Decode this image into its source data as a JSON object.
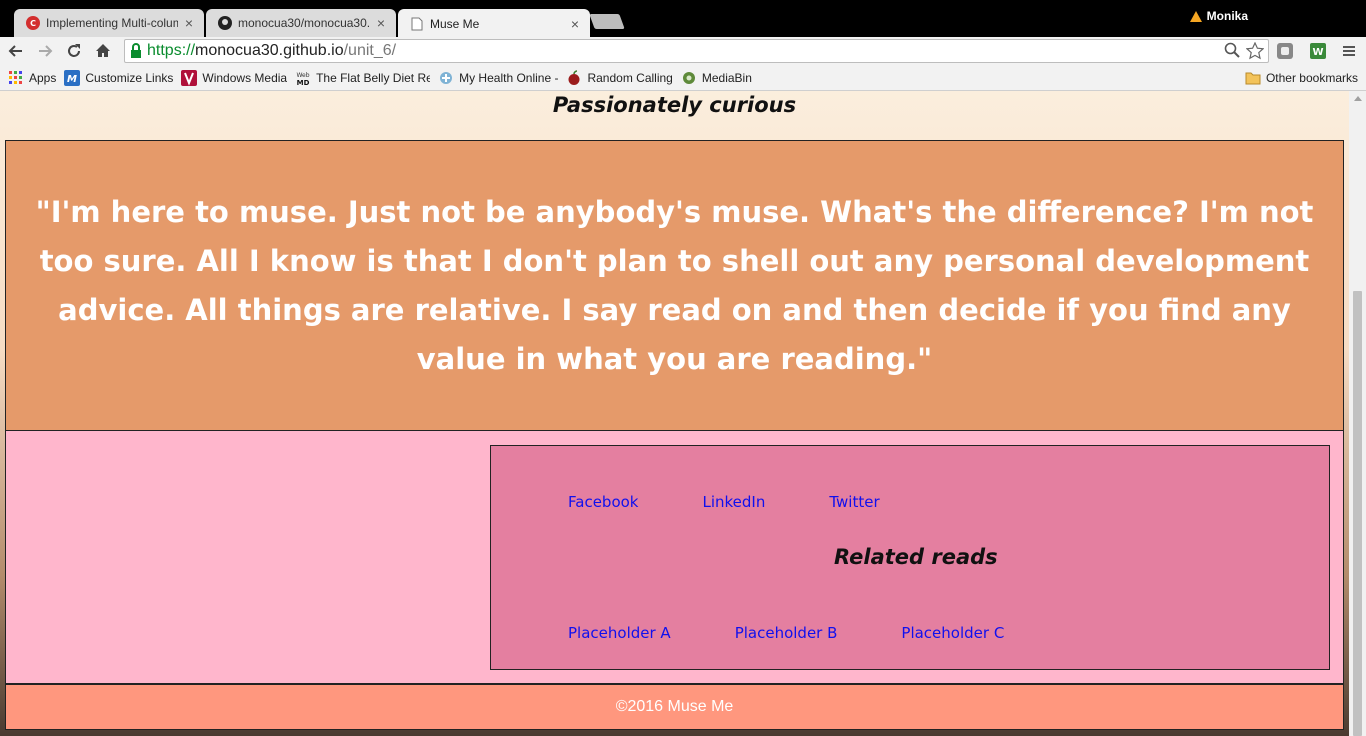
{
  "browser": {
    "tabs": [
      {
        "title": "Implementing Multi-colum",
        "icon": "codecademy-icon",
        "active": false
      },
      {
        "title": "monocua30/monocua30.g",
        "icon": "github-icon",
        "active": false
      },
      {
        "title": "Muse Me",
        "icon": "page-icon",
        "active": true
      }
    ],
    "profile_name": "Monika",
    "address": {
      "scheme": "https://",
      "host": "monocua30.github.io",
      "path": "/unit_6/"
    },
    "bookmarks": [
      {
        "label": "Apps",
        "icon": "apps-grid-icon"
      },
      {
        "label": "Customize Links",
        "icon": "customize-links-icon"
      },
      {
        "label": "Windows Media",
        "icon": "windows-media-icon"
      },
      {
        "label": "The Flat Belly Diet Rev",
        "icon": "webmd-icon"
      },
      {
        "label": "My Health Online -",
        "icon": "health-icon"
      },
      {
        "label": "Random Calling",
        "icon": "apple-icon"
      },
      {
        "label": "MediaBin",
        "icon": "mediabin-icon"
      }
    ],
    "other_bookmarks": "Other bookmarks"
  },
  "page": {
    "tagline": "Passionately curious",
    "quote": "\"I'm here to muse. Just not be anybody's muse. What's the difference? I'm not too sure. All I know is that I don't plan to shell out any personal development advice. All things are relative. I say read on and then decide if you find any value in what you are reading.\"",
    "social_links": [
      "Facebook",
      "LinkedIn",
      "Twitter"
    ],
    "related_title": "Related reads",
    "related_links": [
      "Placeholder A",
      "Placeholder B",
      "Placeholder C"
    ],
    "footer": "©2016 Muse Me"
  },
  "colors": {
    "quote_bg": "#e59a6a",
    "section_bg": "#ffb6cc",
    "links_box_bg": "#e47fa0",
    "footer_bg": "#ff977e",
    "link": "#1010ee"
  }
}
